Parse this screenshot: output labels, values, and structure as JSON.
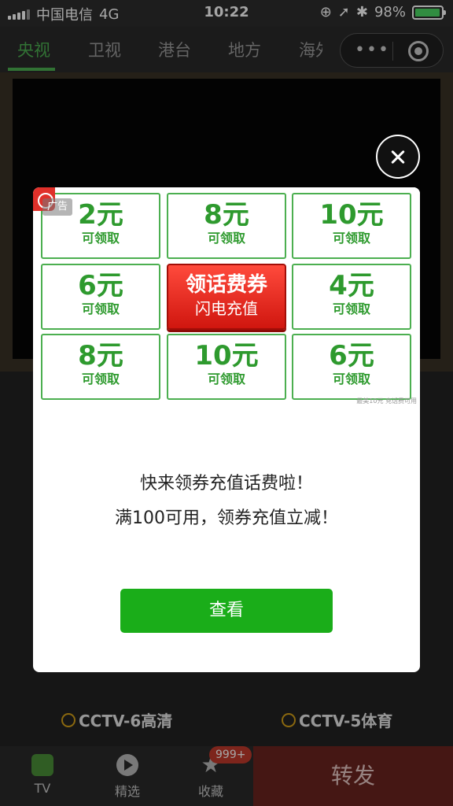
{
  "status_bar": {
    "carrier": "中国电信",
    "network": "4G",
    "time": "10:22",
    "battery": "98%",
    "battery_level": 0.98
  },
  "top_nav": {
    "tabs": [
      "央视",
      "卫视",
      "港台",
      "地方",
      "海外"
    ],
    "active_index": 0,
    "accent_color": "#4caf50"
  },
  "channels": [
    "CCTV-6高清",
    "CCTV-5体育"
  ],
  "bottom_bar": {
    "tv": "TV",
    "featured": "精选",
    "favorites": "收藏",
    "favorites_badge": "999+",
    "share": "转发"
  },
  "ad": {
    "label": "广告",
    "grid": [
      {
        "amount": "2元",
        "sub": "可领取"
      },
      {
        "amount": "8元",
        "sub": "可领取"
      },
      {
        "amount": "10元",
        "sub": "可领取"
      },
      {
        "amount": "6元",
        "sub": "可领取"
      },
      {
        "center": true,
        "main": "领话费券",
        "sub": "闪电充值"
      },
      {
        "amount": "4元",
        "sub": "可领取"
      },
      {
        "amount": "8元",
        "sub": "可领取"
      },
      {
        "amount": "10元",
        "sub": "可领取"
      },
      {
        "amount": "6元",
        "sub": "可领取"
      }
    ],
    "note": "最美10元 充话费可用"
  },
  "modal": {
    "line1": "快来领券充值话费啦！",
    "line2": "满100可用，领券充值立减！",
    "button": "查看",
    "button_color": "#1aad19"
  }
}
